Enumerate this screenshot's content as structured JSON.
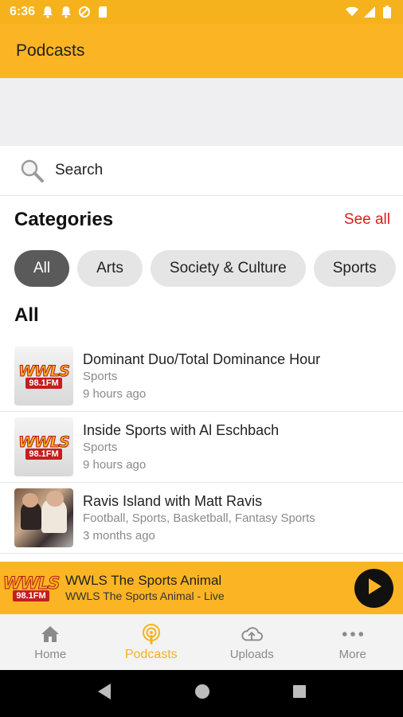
{
  "status_bar": {
    "time": "6:36"
  },
  "app_bar": {
    "title": "Podcasts"
  },
  "search": {
    "placeholder": "Search"
  },
  "categories": {
    "title": "Categories",
    "see_all": "See all",
    "chips": [
      "All",
      "Arts",
      "Society & Culture",
      "Sports"
    ]
  },
  "list": {
    "title": "All",
    "items": [
      {
        "title": "Dominant Duo/Total Dominance Hour",
        "category": "Sports",
        "time": "9 hours ago"
      },
      {
        "title": "Inside Sports with Al Eschbach",
        "category": "Sports",
        "time": "9 hours ago"
      },
      {
        "title": "Ravis Island with Matt Ravis",
        "category": "Football, Sports, Basketball, Fantasy Sports",
        "time": "3 months ago"
      }
    ]
  },
  "logo": {
    "name": "WWLS",
    "freq": "98.1FM"
  },
  "player": {
    "title": "WWLS The Sports Animal",
    "subtitle": "WWLS The Sports Animal - Live"
  },
  "nav": {
    "items": [
      {
        "label": "Home"
      },
      {
        "label": "Podcasts"
      },
      {
        "label": "Uploads"
      },
      {
        "label": "More"
      }
    ]
  },
  "colors": {
    "accent": "#fbb524",
    "active_tab": "#f6b21c",
    "see_all": "#d81e1e",
    "chip_active": "#5a5a5a"
  }
}
